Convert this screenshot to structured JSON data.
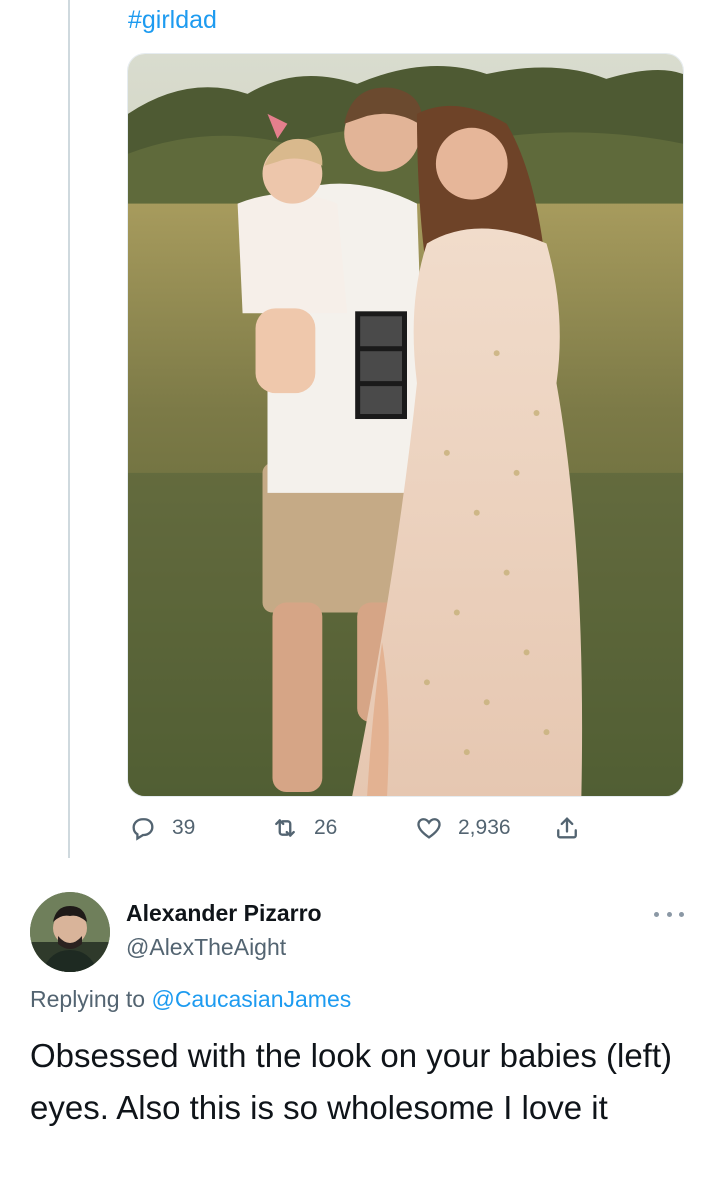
{
  "tweet": {
    "hashtag": "#girldad",
    "photo_icon": "family-photo",
    "stats": {
      "replies": "39",
      "retweets": "26",
      "likes": "2,936"
    },
    "icons": {
      "reply": "reply-icon",
      "retweet": "retweet-icon",
      "like": "heart-icon",
      "share": "share-icon"
    }
  },
  "reply": {
    "author_name": "Alexander Pizarro",
    "author_handle": "@AlexTheAight",
    "replying_prefix": "Replying to ",
    "replying_to": "@CaucasianJames",
    "text": "Obsessed with the look on your babies (left) eyes. Also this is so wholesome I love it"
  },
  "colors": {
    "link": "#1d9bf0",
    "muted": "#536471",
    "text": "#0f1419",
    "thread_line": "#cfd9de"
  }
}
